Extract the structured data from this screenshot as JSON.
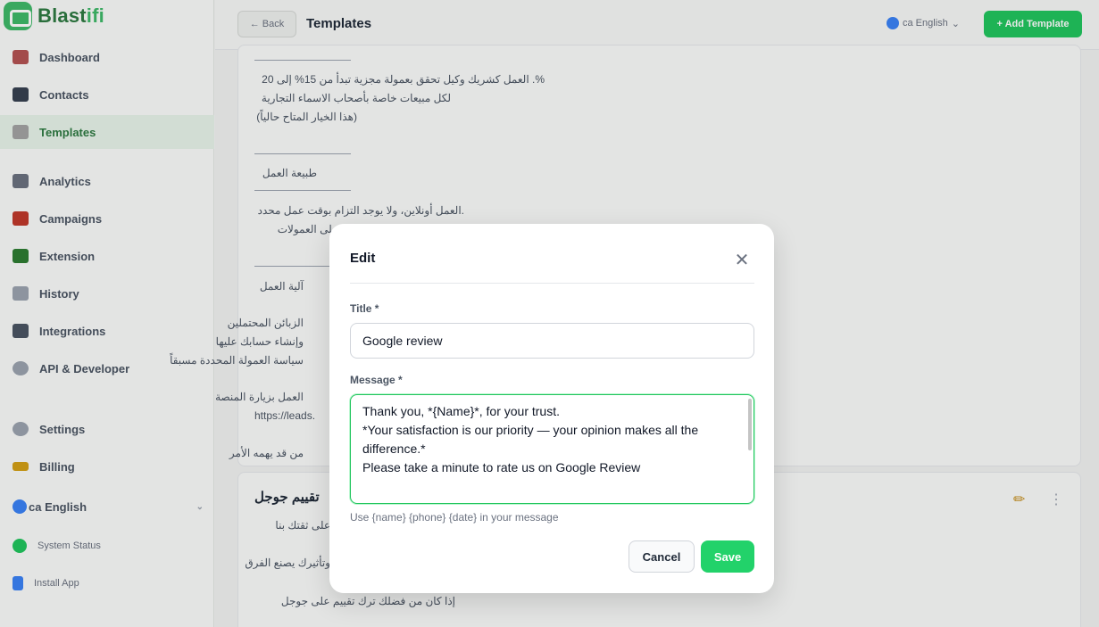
{
  "app": {
    "brand_main": "Blast",
    "brand_accent": "ifi"
  },
  "sidebar": {
    "items": [
      {
        "label": "Dashboard",
        "icon": "home-icon"
      },
      {
        "label": "Contacts",
        "icon": "contacts-icon"
      },
      {
        "label": "Templates",
        "icon": "templates-icon",
        "active": true
      },
      {
        "label": "Analytics",
        "icon": "analytics-icon"
      },
      {
        "label": "Campaigns",
        "icon": "megaphone-icon"
      },
      {
        "label": "Extension",
        "icon": "puzzle-icon"
      },
      {
        "label": "History",
        "icon": "history-icon"
      },
      {
        "label": "Integrations",
        "icon": "plug-icon"
      },
      {
        "label": "API & Developer",
        "icon": "code-icon"
      },
      {
        "label": "Settings",
        "icon": "gear-icon"
      },
      {
        "label": "Billing",
        "icon": "card-icon"
      }
    ],
    "language": "ca English",
    "system_status": "System Status",
    "install_app": "Install App"
  },
  "header": {
    "back_label": "← Back",
    "title": "Templates",
    "language": "ca English",
    "add_label": "+ Add Template"
  },
  "background_card": {
    "lines": [
      "%. العمل كشريك وكيل تحقق بعمولة مجزية تبدأ من 15% إلى 20",
      "لكل مبيعات خاصة بأصحاب الاسماء التجارية",
      "(هذا الخيار المتاح حالياً)",
      "طبيعة العمل",
      ".العمل أونلاين، ولا يوجد التزام بوقت عمل محدد",
      "بل على العمولات",
      "آلية العمل",
      "الزبائن المحتملين",
      "وإنشاء حسابك عليها",
      "سياسة العمولة المحددة مسبقاً",
      "العمل بزيارة المنصة",
      "https://leads.",
      "من قد يهمه الأمر"
    ],
    "card2_title": "تقييم جوجل",
    "card2_lines": [
      "على ثقتك بنا",
      "وتأثيرك يصنع الفرق",
      "إذا كان من فضلك ترك تقييم على جوجل"
    ]
  },
  "modal": {
    "title": "Edit",
    "title_label": "Title *",
    "title_value": "Google review",
    "message_label": "Message *",
    "message_lines": [
      "Thank you, *{Name}*, for your trust.",
      "",
      "*Your satisfaction is our priority — your opinion makes all the difference.*",
      "",
      "Please take a minute to rate us on Google Review"
    ],
    "hint": "Use {name} {phone} {date} in your message",
    "cancel_label": "Cancel",
    "save_label": "Save"
  },
  "colors": {
    "accent": "#22c55e",
    "brand": "#2f7a43",
    "active_bg": "#e7f3ea"
  }
}
